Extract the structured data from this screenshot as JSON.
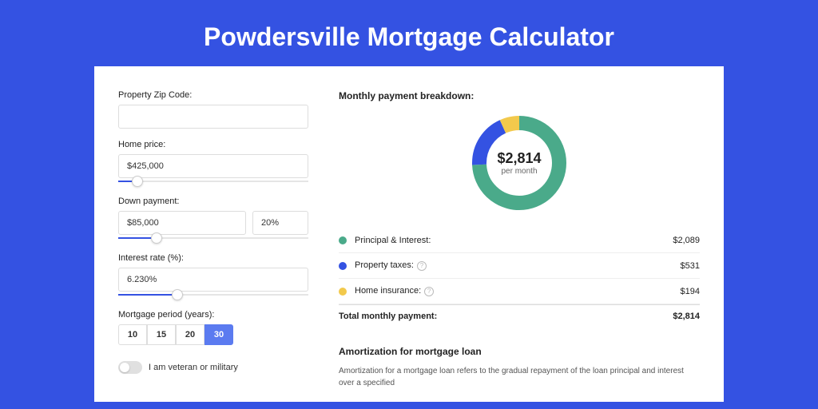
{
  "title": "Powdersville Mortgage Calculator",
  "form": {
    "zip_label": "Property Zip Code:",
    "zip_value": "",
    "home_price_label": "Home price:",
    "home_price_value": "$425,000",
    "home_price_slider_pct": 10,
    "down_label": "Down payment:",
    "down_amount": "$85,000",
    "down_pct": "20%",
    "down_slider_pct": 20,
    "rate_label": "Interest rate (%):",
    "rate_value": "6.230%",
    "rate_slider_pct": 31,
    "period_label": "Mortgage period (years):",
    "periods": [
      "10",
      "15",
      "20",
      "30"
    ],
    "period_active": "30",
    "vet_label": "I am veteran or military"
  },
  "breakdown": {
    "title": "Monthly payment breakdown:",
    "center_value": "$2,814",
    "center_sub": "per month",
    "items": [
      {
        "label": "Principal & Interest:",
        "value": "$2,089",
        "color": "#4aaa8a",
        "pct": 74.2
      },
      {
        "label": "Property taxes:",
        "value": "$531",
        "color": "#3452e2",
        "pct": 18.9,
        "info": true
      },
      {
        "label": "Home insurance:",
        "value": "$194",
        "color": "#f2c94c",
        "pct": 6.9,
        "info": true
      }
    ],
    "total_label": "Total monthly payment:",
    "total_value": "$2,814"
  },
  "amort": {
    "title": "Amortization for mortgage loan",
    "body": "Amortization for a mortgage loan refers to the gradual repayment of the loan principal and interest over a specified"
  },
  "chart_data": {
    "type": "pie",
    "title": "Monthly payment breakdown",
    "series": [
      {
        "name": "Principal & Interest",
        "value": 2089,
        "color": "#4aaa8a"
      },
      {
        "name": "Property taxes",
        "value": 531,
        "color": "#3452e2"
      },
      {
        "name": "Home insurance",
        "value": 194,
        "color": "#f2c94c"
      }
    ],
    "total": 2814,
    "unit": "USD per month"
  }
}
